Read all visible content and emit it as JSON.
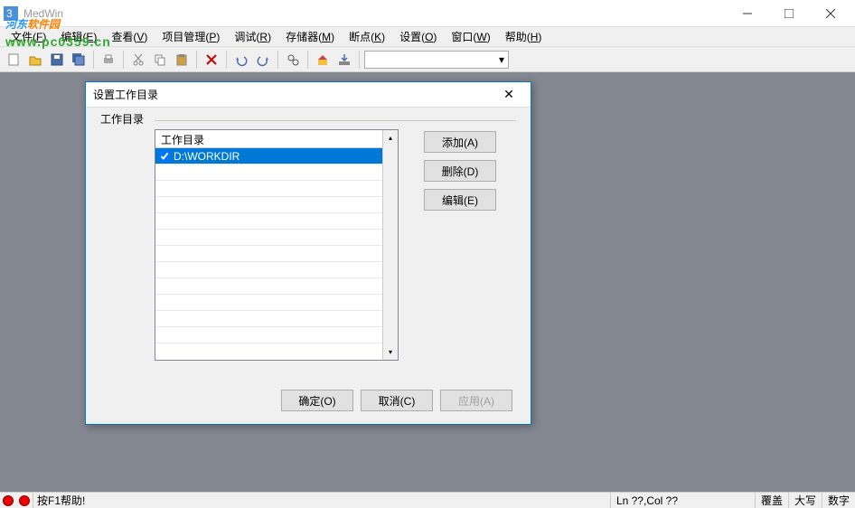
{
  "app": {
    "title": "MedWin"
  },
  "menu": {
    "file": "文件(F)",
    "edit": "编辑(E)",
    "view": "查看(V)",
    "project": "项目管理(P)",
    "debug": "调试(R)",
    "memory": "存储器(M)",
    "breakpoint": "断点(K)",
    "settings": "设置(O)",
    "window": "窗口(W)",
    "help": "帮助(H)"
  },
  "dialog": {
    "title": "设置工作目录",
    "group_label": "工作目录",
    "list_header": "工作目录",
    "items": [
      "D:\\WORKDIR"
    ],
    "btn_add": "添加(A)",
    "btn_delete": "删除(D)",
    "btn_edit": "编辑(E)",
    "btn_ok": "确定(O)",
    "btn_cancel": "取消(C)",
    "btn_apply": "应用(A)"
  },
  "status": {
    "help": "按F1帮助!",
    "pos": "Ln ??,Col ??",
    "overwrite": "覆盖",
    "caps": "大写",
    "num": "数字"
  },
  "watermark": {
    "text1_a": "河东",
    "text1_b": "软件园",
    "url": "www.pc0359.cn"
  }
}
